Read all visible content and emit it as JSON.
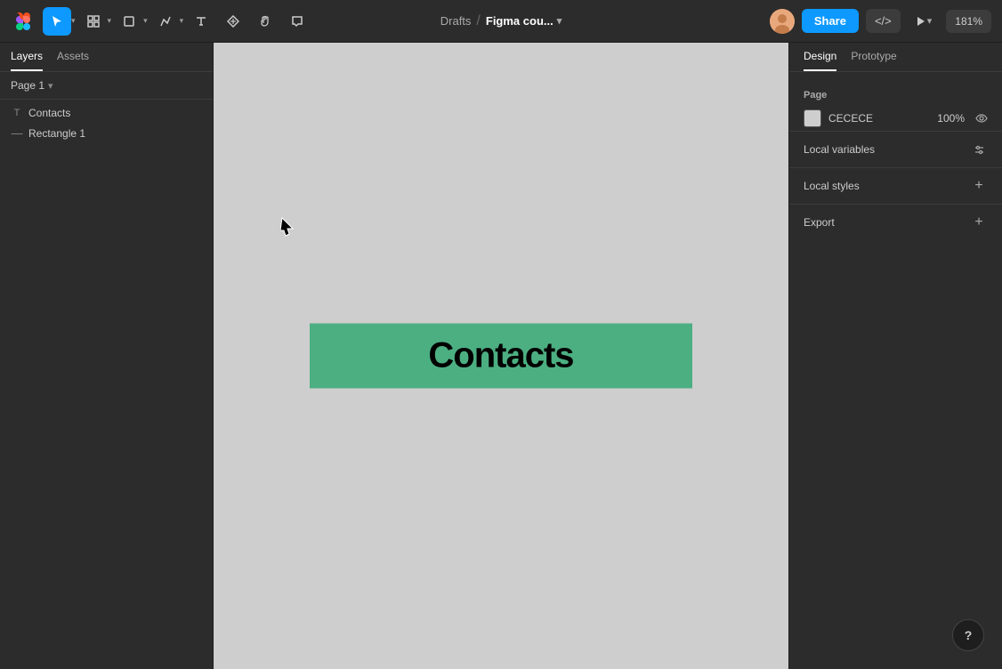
{
  "topbar": {
    "breadcrumb": "Drafts",
    "separator": "/",
    "filename": "Figma cou...",
    "share_label": "Share",
    "code_label": "</>",
    "zoom_label": "181%"
  },
  "left_panel": {
    "tab_layers": "Layers",
    "tab_assets": "Assets",
    "page_name": "Page 1",
    "layers": [
      {
        "name": "Contacts",
        "type": "text",
        "icon": "T"
      },
      {
        "name": "Rectangle 1",
        "type": "rect",
        "icon": "—"
      }
    ]
  },
  "canvas": {
    "bg_color": "#cecece",
    "element_text": "Contacts",
    "element_bg": "#4caf82"
  },
  "right_panel": {
    "tab_design": "Design",
    "tab_prototype": "Prototype",
    "section_page": "Page",
    "page_color_hex": "CECECE",
    "page_color_opacity": "100%",
    "section_local_variables": "Local variables",
    "section_local_styles": "Local styles",
    "section_export": "Export"
  },
  "icons": {
    "cursor": "cursor-icon",
    "frame": "frame-icon",
    "shape": "shape-icon",
    "pen": "pen-icon",
    "text": "text-icon",
    "component": "component-icon",
    "hand": "hand-icon",
    "comment": "comment-icon",
    "play": "play-icon",
    "settings": "settings-icon",
    "eye": "eye-icon",
    "plus": "+",
    "chevron_down": "▾",
    "help": "?"
  }
}
